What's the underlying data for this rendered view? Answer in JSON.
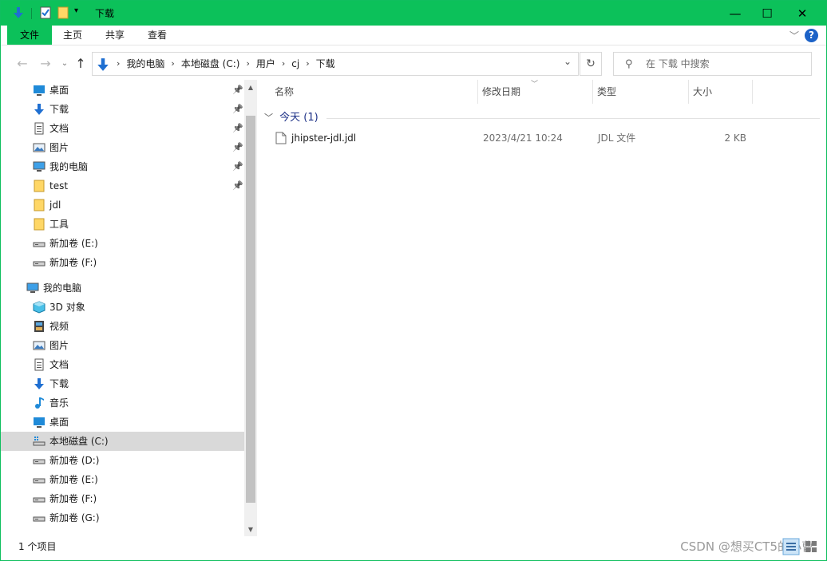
{
  "window": {
    "title": "下载",
    "controls": {
      "minimize": "—",
      "maximize": "☐",
      "close": "✕"
    },
    "accent": "#0cc15a"
  },
  "ribbon": {
    "tabs": [
      {
        "label": "文件"
      },
      {
        "label": "主页"
      },
      {
        "label": "共享"
      },
      {
        "label": "查看"
      }
    ],
    "help": "?"
  },
  "address": {
    "crumbs": [
      "我的电脑",
      "本地磁盘 (C:)",
      "用户",
      "cj",
      "下载"
    ]
  },
  "search": {
    "placeholder": "在 下载 中搜索"
  },
  "sidebar": {
    "quick_access": [
      {
        "label": "桌面",
        "icon": "desktop-icon",
        "pinned": true
      },
      {
        "label": "下载",
        "icon": "download-icon",
        "pinned": true
      },
      {
        "label": "文档",
        "icon": "document-icon",
        "pinned": true
      },
      {
        "label": "图片",
        "icon": "picture-icon",
        "pinned": true
      },
      {
        "label": "我的电脑",
        "icon": "computer-icon",
        "pinned": true
      },
      {
        "label": "test",
        "icon": "folder-icon",
        "pinned": true
      },
      {
        "label": "jdl",
        "icon": "folder-icon",
        "pinned": false
      },
      {
        "label": "工具",
        "icon": "folder-icon",
        "pinned": false
      },
      {
        "label": "新加卷 (E:)",
        "icon": "drive-icon",
        "pinned": false
      },
      {
        "label": "新加卷 (F:)",
        "icon": "drive-icon",
        "pinned": false
      }
    ],
    "this_pc": {
      "label": "我的电脑",
      "icon": "computer-icon"
    },
    "pc_items": [
      {
        "label": "3D 对象",
        "icon": "3d-objects-icon"
      },
      {
        "label": "视频",
        "icon": "video-icon"
      },
      {
        "label": "图片",
        "icon": "picture-icon"
      },
      {
        "label": "文档",
        "icon": "document-icon"
      },
      {
        "label": "下载",
        "icon": "download-icon"
      },
      {
        "label": "音乐",
        "icon": "music-icon"
      },
      {
        "label": "桌面",
        "icon": "desktop-icon"
      },
      {
        "label": "本地磁盘 (C:)",
        "icon": "system-drive-icon",
        "selected": true
      },
      {
        "label": "新加卷 (D:)",
        "icon": "drive-icon"
      },
      {
        "label": "新加卷 (E:)",
        "icon": "drive-icon"
      },
      {
        "label": "新加卷 (F:)",
        "icon": "drive-icon"
      },
      {
        "label": "新加卷 (G:)",
        "icon": "drive-icon"
      }
    ]
  },
  "columns": {
    "name": "名称",
    "modified": "修改日期",
    "type": "类型",
    "size": "大小"
  },
  "group": {
    "label": "今天 (1)"
  },
  "files": [
    {
      "name": "jhipster-jdl.jdl",
      "modified": "2023/4/21 10:24",
      "type": "JDL 文件",
      "size": "2 KB"
    }
  ],
  "status": {
    "count": "1 个项目"
  },
  "watermark": "CSDN @想买CT5的小曹"
}
